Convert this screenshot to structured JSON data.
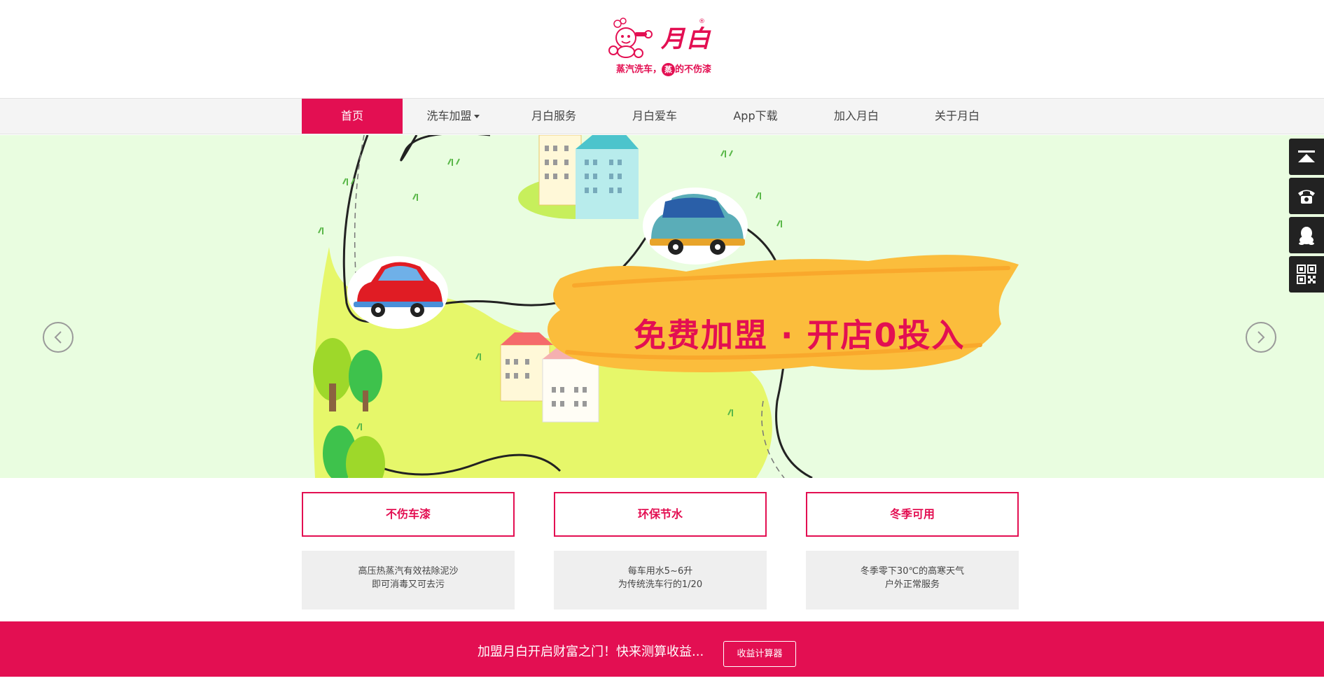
{
  "header": {
    "logo_name": "月白",
    "logo_reg": "®",
    "slogan_before": "蒸汽洗车，",
    "slogan_circle": "蒸",
    "slogan_after": "的不伤漆"
  },
  "nav": {
    "items": [
      {
        "label": "首页",
        "active": true
      },
      {
        "label": "洗车加盟"
      },
      {
        "label": "月白服务"
      },
      {
        "label": "月白爱车"
      },
      {
        "label": "App下载"
      },
      {
        "label": "加入月白"
      },
      {
        "label": "关于月白"
      }
    ]
  },
  "banner": {
    "headline": "免费加盟 · 开店0投入",
    "prev_icon": "chevron-left-icon",
    "next_icon": "chevron-right-icon",
    "bg_color": "#e9fde0"
  },
  "sidebar": {
    "tools": [
      {
        "icon": "back-to-top-icon"
      },
      {
        "icon": "telephone-icon"
      },
      {
        "icon": "qq-penguin-icon"
      },
      {
        "icon": "qr-code-icon"
      }
    ]
  },
  "features": [
    {
      "title": "不伤车漆",
      "line1": "高压热蒸汽有效祛除泥沙",
      "line2": "即可消毒又可去污"
    },
    {
      "title": "环保节水",
      "line1": "每车用水5~6升",
      "line2": "为传统洗车行的1/20"
    },
    {
      "title": "冬季可用",
      "line1": "冬季零下30℃的高寒天气",
      "line2": "户外正常服务"
    }
  ],
  "bottom_bar": {
    "text": "加盟月白开启财富之门！快来测算收益...",
    "button_label": "收益计算器"
  },
  "colors": {
    "brand": "#e30f52",
    "nav_bg": "#f4f4f4",
    "sidebar_bg": "#222222"
  }
}
